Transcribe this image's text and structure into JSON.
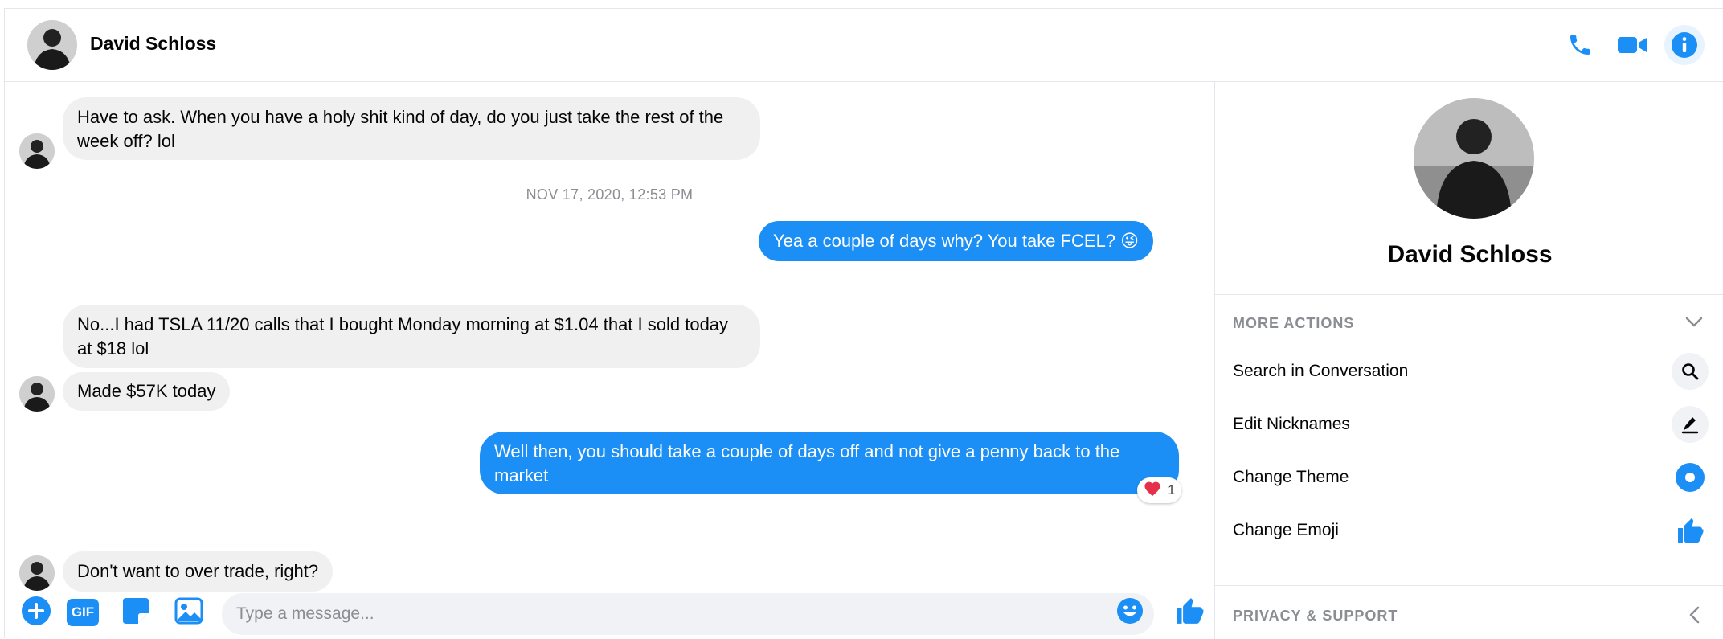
{
  "header": {
    "contact_name": "David Schloss"
  },
  "messages": {
    "m1": "Have to ask. When you have a holy shit kind of day, do you just take the rest of the week off? lol",
    "timestamp": "NOV 17, 2020, 12:53 PM",
    "m2": "Yea a couple of days why? You take FCEL? 😜",
    "m3": "No...I had TSLA 11/20 calls that I bought Monday morning at $1.04 that I sold today at $18 lol",
    "m4": "Made $57K today",
    "m5": "Well then, you should take a couple of days off and not give a penny back to the market",
    "m5_reaction_count": "1",
    "m6": "Don't want to over trade, right?"
  },
  "composer": {
    "placeholder": "Type a message...",
    "gif_label": "GIF"
  },
  "panel": {
    "name": "David Schloss",
    "more_actions_title": "MORE ACTIONS",
    "actions": [
      {
        "label": "Search in Conversation",
        "icon": "search-icon"
      },
      {
        "label": "Edit Nicknames",
        "icon": "pencil-icon"
      },
      {
        "label": "Change Theme",
        "icon": "theme-icon"
      },
      {
        "label": "Change Emoji",
        "icon": "thumbs-up-icon"
      }
    ],
    "privacy_title": "PRIVACY & SUPPORT"
  },
  "colors": {
    "accent": "#1b8ff5",
    "incoming_bubble": "#f0f0f0",
    "reaction_heart": "#e4304b"
  }
}
